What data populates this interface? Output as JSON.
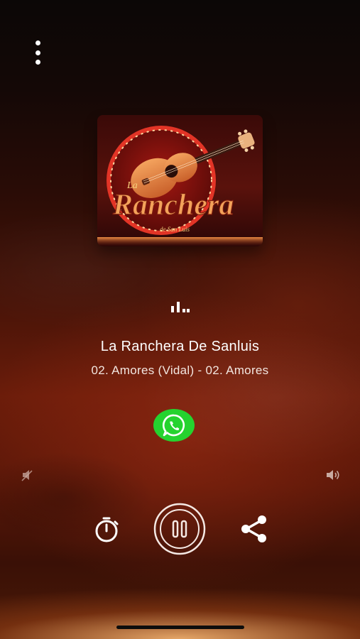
{
  "station": {
    "name": "La Ranchera De Sanluis",
    "track": "02. Amores (Vidal) - 02. Amores"
  },
  "logo": {
    "brand_small": "La",
    "brand_main": "Ranchera",
    "brand_sub": "de San Luis"
  },
  "icons": {
    "menu": "more-vertical-icon",
    "equalizer": "equalizer-bars-icon",
    "whatsapp": "whatsapp-icon",
    "volume_mute": "volume-mute-icon",
    "volume_up": "volume-up-icon",
    "timer": "sleep-timer-icon",
    "pause": "pause-icon",
    "share": "share-icon"
  },
  "colors": {
    "whatsapp_green": "#25d32f",
    "accent_red": "#c8231a",
    "logo_gold": "#f3a25a"
  }
}
